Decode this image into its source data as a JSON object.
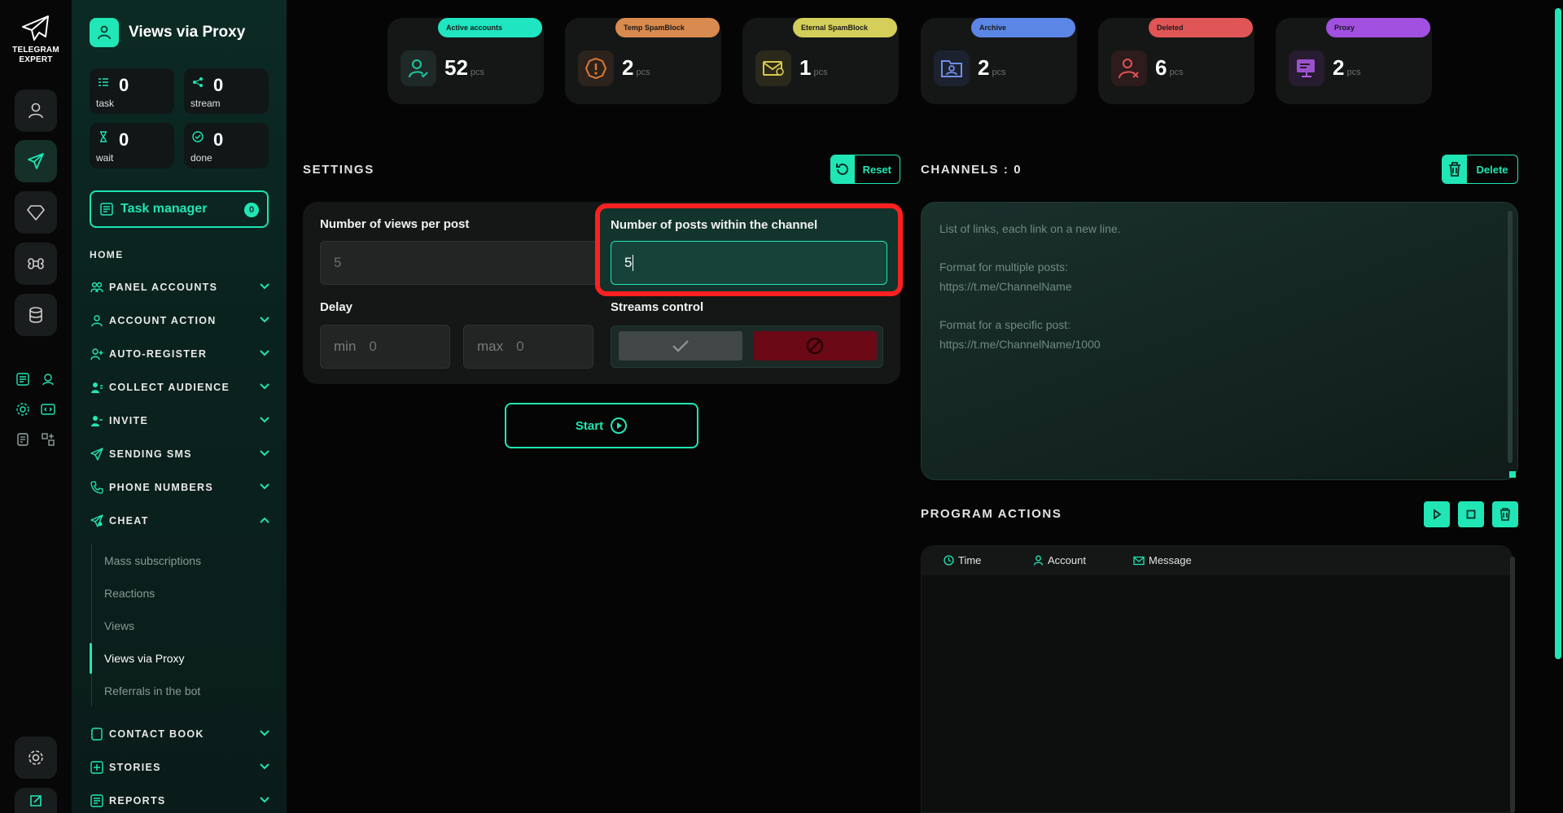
{
  "logo": {
    "text": "TELEGRAM\nEXPERT"
  },
  "app": {
    "title": "Views via Proxy"
  },
  "stats": [
    {
      "value": "0",
      "label": "task"
    },
    {
      "value": "0",
      "label": "stream"
    },
    {
      "value": "0",
      "label": "wait"
    },
    {
      "value": "0",
      "label": "done"
    }
  ],
  "task_manager": {
    "label": "Task manager",
    "count": "0"
  },
  "nav": {
    "home": "HOME",
    "sections": [
      {
        "label": "PANEL ACCOUNTS",
        "icon": "users-icon"
      },
      {
        "label": "ACCOUNT ACTION",
        "icon": "user-icon"
      },
      {
        "label": "AUTO-REGISTER",
        "icon": "user-plus-icon"
      },
      {
        "label": "COLLECT AUDIENCE",
        "icon": "audience-icon"
      },
      {
        "label": "INVITE",
        "icon": "invite-icon"
      },
      {
        "label": "SENDING SMS",
        "icon": "send-icon"
      },
      {
        "label": "PHONE NUMBERS",
        "icon": "phone-icon"
      },
      {
        "label": "CHEAT",
        "icon": "cheat-icon"
      }
    ],
    "cheat_items": [
      "Mass subscriptions",
      "Reactions",
      "Views",
      "Views via Proxy",
      "Referrals in the bot"
    ],
    "bottom_sections": [
      {
        "label": "CONTACT BOOK",
        "icon": "contact-book-icon"
      },
      {
        "label": "STORIES",
        "icon": "stories-icon"
      },
      {
        "label": "REPORTS",
        "icon": "reports-icon"
      }
    ]
  },
  "cards": [
    {
      "pill": "Active accounts",
      "value": "52",
      "unit": "pcs",
      "pill_color": "#1fe6c0",
      "icon": "user-check-icon",
      "icon_color": "#20c9a0"
    },
    {
      "pill": "Temp SpamBlock",
      "value": "2",
      "unit": "pcs",
      "pill_color": "#d98a4e",
      "icon": "warning-icon",
      "icon_color": "#e07a35"
    },
    {
      "pill": "Eternal SpamBlock",
      "value": "1",
      "unit": "pcs",
      "pill_color": "#d4cf5a",
      "icon": "mail-block-icon",
      "icon_color": "#d9c94a"
    },
    {
      "pill": "Archive",
      "value": "2",
      "unit": "pcs",
      "pill_color": "#5b86e6",
      "icon": "archive-folder-icon",
      "icon_color": "#6e8fe6"
    },
    {
      "pill": "Deleted",
      "value": "6",
      "unit": "pcs",
      "pill_color": "#e05555",
      "icon": "user-x-icon",
      "icon_color": "#e05555"
    },
    {
      "pill": "Proxy",
      "value": "2",
      "unit": "pcs",
      "pill_color": "#a150e0",
      "icon": "proxy-icon",
      "icon_color": "#b05ae6"
    }
  ],
  "settings": {
    "title": "SETTINGS",
    "reset_label": "Reset",
    "views_label": "Number of views per post",
    "views_value": "5",
    "posts_label": "Number of posts within the channel",
    "posts_value": "5",
    "delay_label": "Delay",
    "delay_min_prefix": "min",
    "delay_min": "0",
    "delay_max_prefix": "max",
    "delay_max": "0",
    "streams_label": "Streams control",
    "start_label": "Start"
  },
  "channels": {
    "title": "CHANNELS : 0",
    "delete_label": "Delete",
    "placeholder_lines": [
      "List of links, each link on a new line.",
      "Format for multiple posts:",
      "https://t.me/ChannelName",
      "Format for a specific post:",
      "https://t.me/ChannelName/1000"
    ]
  },
  "program_actions": {
    "title": "PROGRAM ACTIONS",
    "columns": [
      "Time",
      "Account",
      "Message"
    ]
  },
  "colors": {
    "accent": "#20e6b5",
    "highlight": "#ff2121",
    "danger": "#6b0a16"
  }
}
